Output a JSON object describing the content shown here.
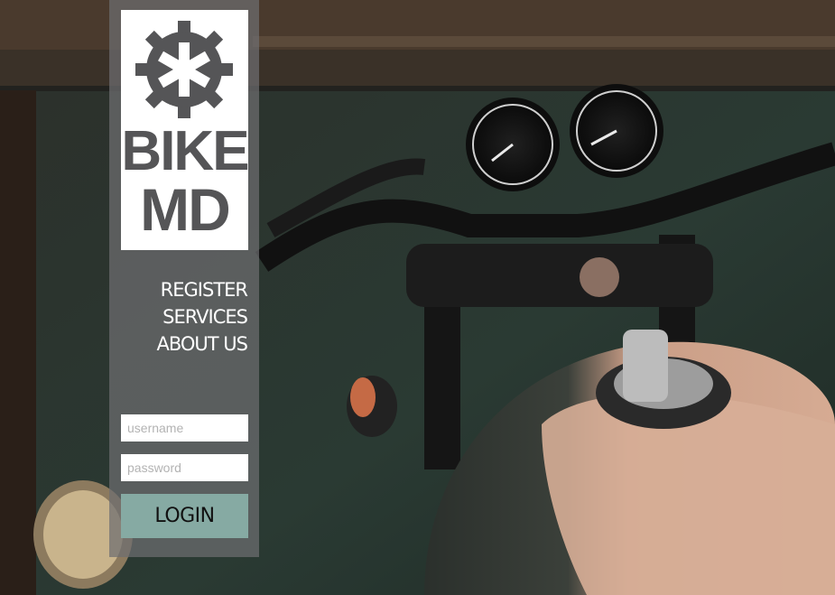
{
  "brand": {
    "line1": "BIKE",
    "line2": "MD",
    "logo_color": "#555557"
  },
  "nav": {
    "items": [
      {
        "label": "REGISTER"
      },
      {
        "label": "SERVICES"
      },
      {
        "label": "ABOUT US"
      }
    ]
  },
  "login": {
    "username_placeholder": "username",
    "password_placeholder": "password",
    "button_label": "LOGIN",
    "button_color": "#86aaa3"
  },
  "background": {
    "subject": "motorcycle-photo"
  }
}
